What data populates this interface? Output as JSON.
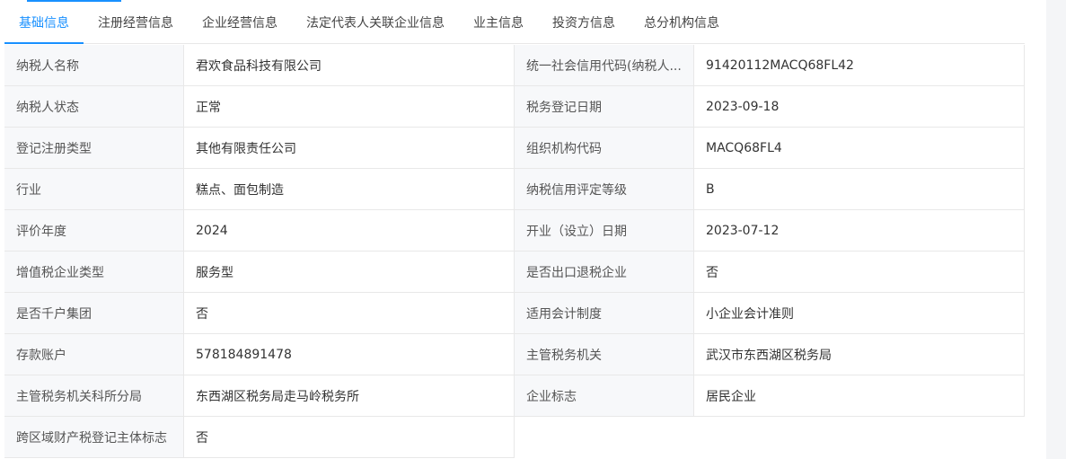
{
  "tabs": [
    {
      "label": "基础信息",
      "active": true
    },
    {
      "label": "注册经营信息",
      "active": false
    },
    {
      "label": "企业经营信息",
      "active": false
    },
    {
      "label": "法定代表人关联企业信息",
      "active": false
    },
    {
      "label": "业主信息",
      "active": false
    },
    {
      "label": "投资方信息",
      "active": false
    },
    {
      "label": "总分机构信息",
      "active": false
    }
  ],
  "rows": [
    {
      "l1": "纳税人名称",
      "v1": "君欢食品科技有限公司",
      "l2": "统一社会信用代码(纳税人...",
      "v2": "91420112MACQ68FL42"
    },
    {
      "l1": "纳税人状态",
      "v1": "正常",
      "l2": "税务登记日期",
      "v2": "2023-09-18"
    },
    {
      "l1": "登记注册类型",
      "v1": "其他有限责任公司",
      "l2": "组织机构代码",
      "v2": "MACQ68FL4"
    },
    {
      "l1": "行业",
      "v1": "糕点、面包制造",
      "l2": "纳税信用评定等级",
      "v2": "B"
    },
    {
      "l1": "评价年度",
      "v1": "2024",
      "l2": "开业（设立）日期",
      "v2": "2023-07-12"
    },
    {
      "l1": "增值税企业类型",
      "v1": "服务型",
      "l2": "是否出口退税企业",
      "v2": "否"
    },
    {
      "l1": "是否千户集团",
      "v1": "否",
      "l2": "适用会计制度",
      "v2": "小企业会计准则"
    },
    {
      "l1": "存款账户",
      "v1": "578184891478",
      "l2": "主管税务机关",
      "v2": "武汉市东西湖区税务局"
    },
    {
      "l1": "主管税务机关科所分局",
      "v1": "东西湖区税务局走马岭税务所",
      "l2": "企业标志",
      "v2": "居民企业"
    },
    {
      "l1": "跨区域财产税登记主体标志",
      "v1": "否"
    }
  ],
  "colors": {
    "accent": "#1890ff",
    "label_bg": "#f7f8fa",
    "border": "#e8e8e8"
  }
}
